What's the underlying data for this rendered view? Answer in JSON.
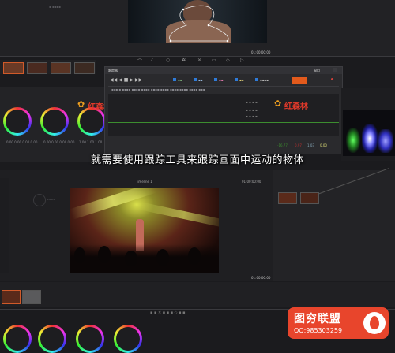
{
  "subtitle": "就需要使用跟踪工具来跟踪画面中运动的物体",
  "tracker_window": {
    "title": "跟踪器",
    "right_label": "窗口"
  },
  "watermark_left": "红森林",
  "watermark_right": "红森林",
  "brand": {
    "name": "图穷联盟",
    "qq": "QQ:985303259"
  },
  "top_timecode": "01:00:00:00",
  "bottom_timecode": "01:00:00:00",
  "timeline_label": "Timeline 1",
  "graph_values": [
    "-16.77",
    "0.97",
    "1.03",
    "0.00"
  ],
  "colors": {
    "accent": "#e25a1c",
    "brand_red": "#e8452c",
    "graph_green": "#3c8d2f",
    "graph_red": "#c03030"
  }
}
